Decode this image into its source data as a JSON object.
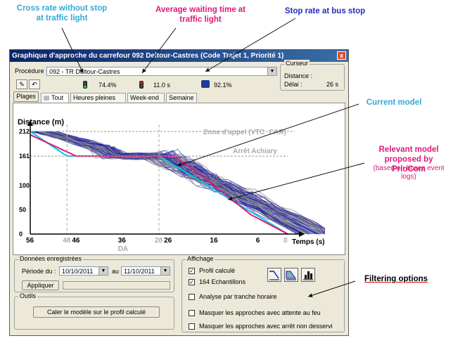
{
  "annotations": {
    "cross_rate": "Cross rate without stop at traffic light",
    "avg_wait": "Average waiting time at traffic light",
    "stop_rate": "Stop rate at bus stop",
    "current_model": "Current model",
    "relevant_model": "Relevant model proposed by PrioCom",
    "relevant_model_sub": "(based on buses event logs)",
    "filtering": "Filtering options"
  },
  "window": {
    "title": "Graphique d'approche du carrefour 092 Deltour-Castres (Code Trajet 1, Priorité 1)",
    "close": "x"
  },
  "toolbar": {
    "procedure_label": "Procédure :",
    "procedure_value": "092 - TR Deltour-Castres",
    "cross_rate_value": "74.4%",
    "avg_wait_value": "11.0 s",
    "stop_rate_value": "92.1%",
    "cursor_group": "Curseur",
    "distance_label": "Distance :",
    "distance_value": "",
    "delay_label": "Délai :",
    "delay_value": "26 s"
  },
  "tabs": {
    "plages": "Plages ...",
    "items": [
      "Tout",
      "Heures pleines",
      "Week-end",
      "Semaine"
    ],
    "active": "Tout"
  },
  "chart_data": {
    "type": "line",
    "ylabel": "Distance (m)",
    "xlabel": "Temps (s)",
    "x_ticks": [
      "56",
      "46",
      "36",
      "26",
      "16",
      "6"
    ],
    "x_extra_labels": [
      "48",
      "28",
      "0"
    ],
    "x_sub_label": "DA",
    "y_ticks": [
      "212",
      "161",
      "100",
      "50",
      "0"
    ],
    "annotations": [
      "Zone d'appel (VTC_CAR)",
      "Arrêt Achiary"
    ],
    "colors": {
      "samples_blue": "#1b1bb0",
      "samples_gray": "#8a8a8a",
      "current": "#00c8e0",
      "relevant": "#e0187a"
    }
  },
  "donnees": {
    "title": "Données enregistrées",
    "period_label": "Période du :",
    "from": "10/10/2011",
    "to_label": "au",
    "to": "11/10/2011",
    "apply": "Appliquer"
  },
  "outils": {
    "title": "Outils",
    "button": "Caler le modèle sur le profil calculé"
  },
  "affichage": {
    "title": "Affichage",
    "profil": "Profil calculé",
    "echantillons": "164 Echantillons",
    "analyse": "Analyse par tranche horaire",
    "masquer_feu": "Masquer les approches avec attente au feu",
    "masquer_arret": "Masquer les approches avec arrêt non desservi"
  }
}
